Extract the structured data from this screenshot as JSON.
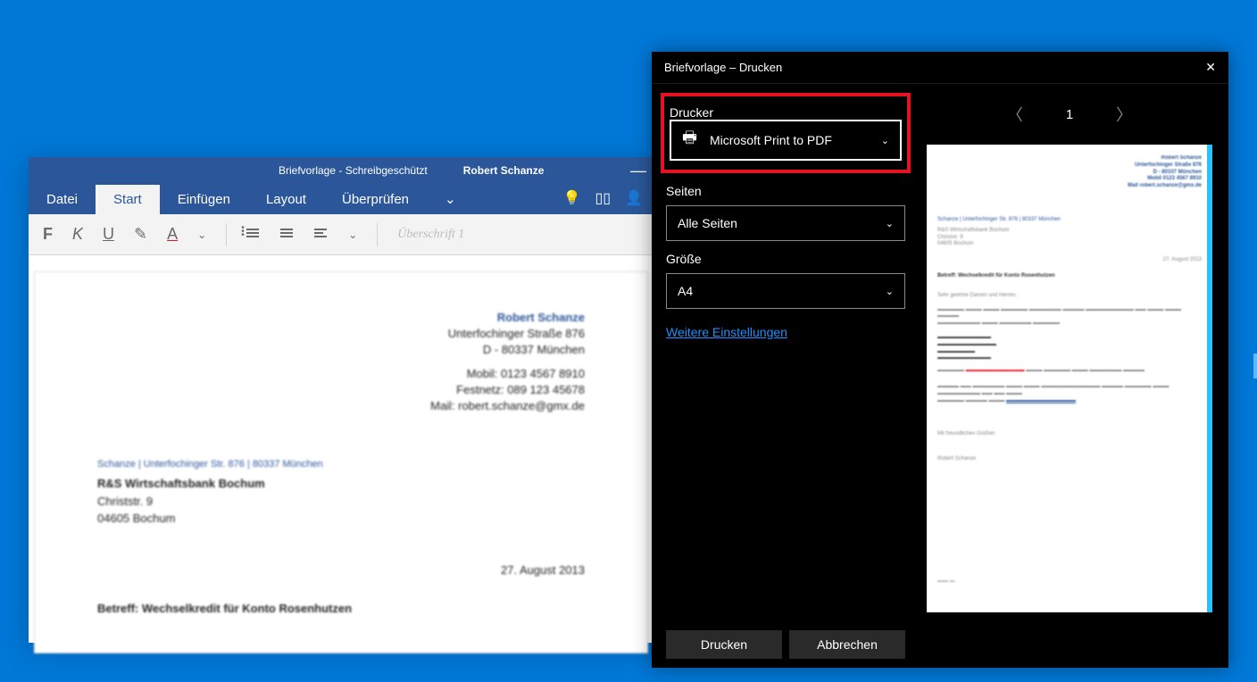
{
  "word": {
    "doc_title": "Briefvorlage - Schreibgeschützt",
    "user": "Robert Schanze",
    "tabs": {
      "datei": "Datei",
      "start": "Start",
      "einfuegen": "Einfügen",
      "layout": "Layout",
      "ueberpruefen": "Überprüfen"
    },
    "style_placeholder": "Überschrift 1",
    "doc": {
      "sender_name": "Robert Schanze",
      "sender_addr1": "Unterfochinger Straße 876",
      "sender_addr2": "D - 80337 München",
      "sender_mob": "Mobil: 0123 4567 8910",
      "sender_fest": "Festnetz: 089 123 45678",
      "sender_mail": "Mail: robert.schanze@gmx.de",
      "sender_line": "Schanze | Unterfochinger Str. 876 | 80337 München",
      "recipient1": "R&S Wirtschaftsbank Bochum",
      "recipient2": "Christstr. 9",
      "recipient3": "04605 Bochum",
      "date": "27. August 2013",
      "subject": "Betreff: Wechselkredit für Konto Rosenhutzen"
    }
  },
  "print": {
    "title": "Briefvorlage – Drucken",
    "label_printer": "Drucker",
    "printer_value": "Microsoft Print to PDF",
    "label_pages": "Seiten",
    "pages_value": "Alle Seiten",
    "label_size": "Größe",
    "size_value": "A4",
    "more_settings": "Weitere Einstellungen",
    "page_number": "1",
    "btn_print": "Drucken",
    "btn_cancel": "Abbrechen"
  }
}
